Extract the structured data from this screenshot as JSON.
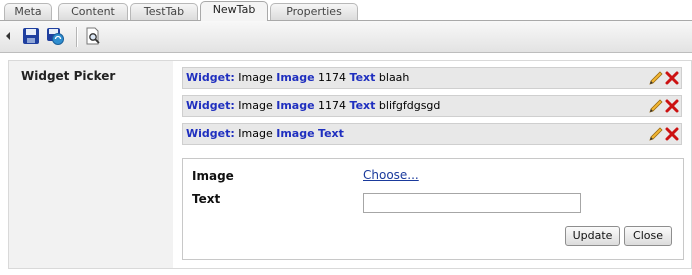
{
  "tabs": [
    {
      "label": "Meta",
      "active": false
    },
    {
      "label": "Content",
      "active": false
    },
    {
      "label": "TestTab",
      "active": false
    },
    {
      "label": "NewTab",
      "active": true
    },
    {
      "label": "Properties",
      "active": false
    }
  ],
  "toolbar": {
    "icons": [
      "collapse-arrow-icon",
      "save-icon",
      "save-publish-icon",
      "preview-icon"
    ]
  },
  "field": {
    "label": "Widget Picker"
  },
  "widgets": [
    {
      "prefix": "Widget:",
      "type": "Image",
      "image_key": "Image",
      "image_val": "1174",
      "text_key": "Text",
      "text_val": "blaah"
    },
    {
      "prefix": "Widget:",
      "type": "Image",
      "image_key": "Image",
      "image_val": "1174",
      "text_key": "Text",
      "text_val": "blifgfdgsgd"
    },
    {
      "prefix": "Widget:",
      "type": "Image",
      "image_key": "Image",
      "image_val": "",
      "text_key": "Text",
      "text_val": ""
    }
  ],
  "editor": {
    "image_label": "Image",
    "choose_link": "Choose...",
    "text_label": "Text",
    "text_value": "",
    "update_button": "Update",
    "close_button": "Close"
  },
  "colors": {
    "keyword": "#1f2fbf",
    "link": "#1a3a9c",
    "delete": "#cc1111",
    "pencil": "#e0a020"
  }
}
